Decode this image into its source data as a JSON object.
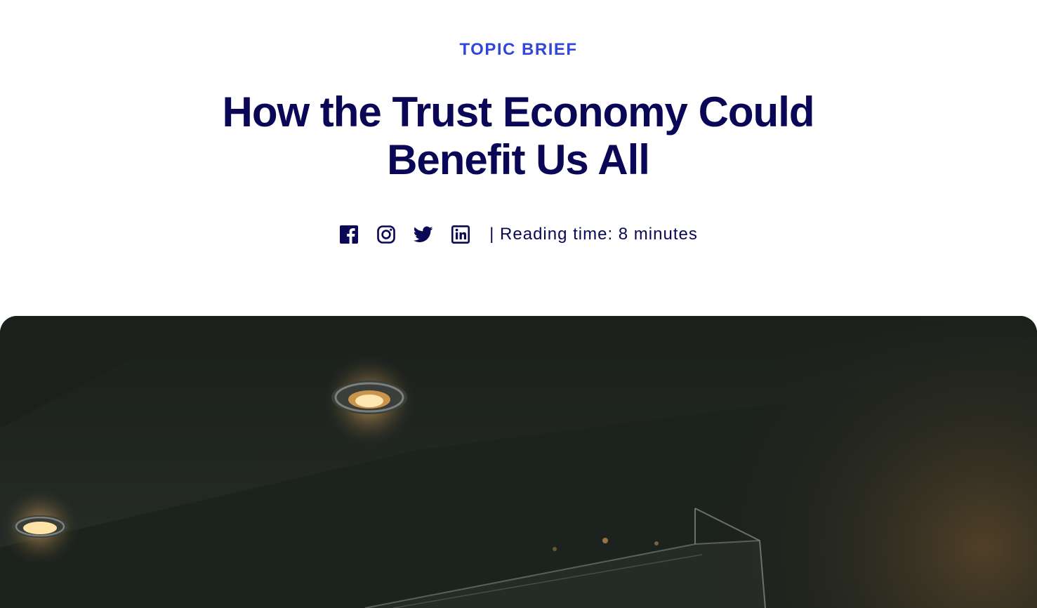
{
  "article": {
    "kicker": "TOPIC BRIEF",
    "title": "How the Trust Economy Could Benefit Us All",
    "reading_time": "| Reading time: 8 minutes"
  },
  "share": {
    "icons": [
      "facebook-icon",
      "instagram-icon",
      "twitter-icon",
      "linkedin-icon"
    ]
  },
  "colors": {
    "kicker": "#3347d6",
    "title": "#0b0757",
    "icon": "#0b0757",
    "hero_bg": "#1c211d"
  }
}
